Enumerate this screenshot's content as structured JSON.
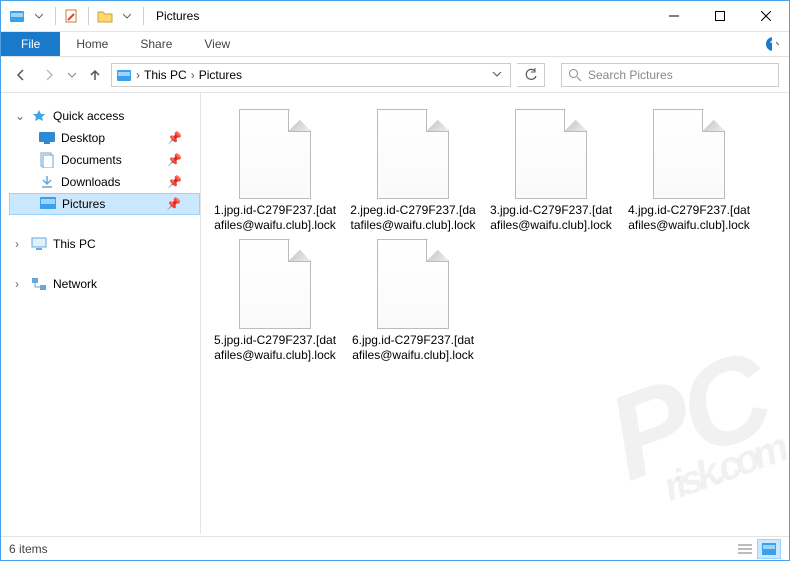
{
  "titlebar": {
    "title": "Pictures"
  },
  "win_controls": {
    "min": "—",
    "max": "☐",
    "close": "✕"
  },
  "ribbon": {
    "file": "File",
    "tabs": [
      "Home",
      "Share",
      "View"
    ]
  },
  "nav": {
    "back": "←",
    "forward": "→",
    "up": "↑",
    "refresh": "↻",
    "this_pc": "This PC",
    "current": "Pictures"
  },
  "search": {
    "placeholder": "Search Pictures"
  },
  "sidebar": {
    "quick_access": "Quick access",
    "items": [
      {
        "label": "Desktop"
      },
      {
        "label": "Documents"
      },
      {
        "label": "Downloads"
      },
      {
        "label": "Pictures"
      }
    ],
    "this_pc": "This PC",
    "network": "Network"
  },
  "files": [
    {
      "name": "1.jpg.id-C279F237.[datafiles@waifu.club].lock"
    },
    {
      "name": "2.jpeg.id-C279F237.[datafiles@waifu.club].lock"
    },
    {
      "name": "3.jpg.id-C279F237.[datafiles@waifu.club].lock"
    },
    {
      "name": "4.jpg.id-C279F237.[datafiles@waifu.club].lock"
    },
    {
      "name": "5.jpg.id-C279F237.[datafiles@waifu.club].lock"
    },
    {
      "name": "6.jpg.id-C279F237.[datafiles@waifu.club].lock"
    }
  ],
  "status": {
    "count": "6 items"
  },
  "watermark": {
    "main": "PC",
    "sub": "risk.com"
  }
}
